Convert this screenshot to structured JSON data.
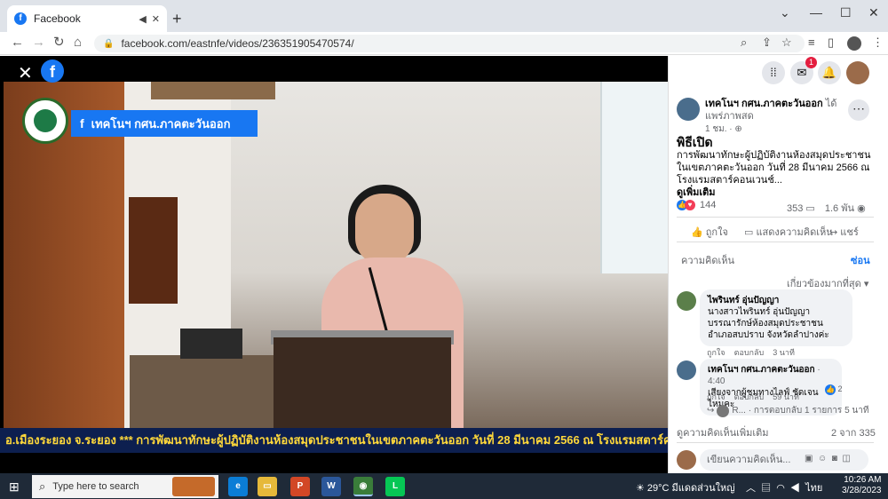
{
  "browser": {
    "tab_title": "Facebook",
    "new_tab": "+",
    "url": "facebook.com/eastnfe/videos/236351905470574/",
    "window_controls": [
      "⌄",
      "—",
      "☐",
      "✕"
    ]
  },
  "video": {
    "close_icon": "✕",
    "page_banner": "เทคโนฯ กศน.ภาคตะวันออก",
    "ticker": "อ.เมืองระยอง จ.ระยอง   *** การพัฒนาทักษะผู้ปฏิบัติงานห้องสมุดประชาชนในเขตภาคตะวันออก วันที่ 28 มีนาคม 2566 ณ โรงแรมสตาร์คอน"
  },
  "panel": {
    "notification_count": "1",
    "post": {
      "author": "เทคโนฯ กศน.ภาคตะวันออก",
      "author_suffix": "ได้แพร่ภาพสด",
      "time": "1 ชม. · ",
      "title": "พิธีเปิด",
      "description": "การพัฒนาทักษะผู้ปฏิบัติงานห้องสมุดประชาชนในเขตภาคตะวันออก วันที่ 28 มีนาคม 2566 ณ โรงแรมสตาร์คอนเวนช์...",
      "see_more": "ดูเพิ่มเติม",
      "reactions_count": "144",
      "comments_count": "353",
      "views_count": "1.6 พัน"
    },
    "actions": {
      "like": "ถูกใจ",
      "comment": "แสดงความคิดเห็น",
      "share": "แชร์"
    },
    "comments_label": "ความคิดเห็น",
    "hide_label": "ซ่อน",
    "sort_label": "เกี่ยวข้องมากที่สุด",
    "comments": [
      {
        "author": "ไพรินทร์ อุ่นปัญญา",
        "text": "นางสาวไพรินทร์ อุ่นปัญญา บรรณารักษ์ห้องสมุดประชาชนอำเภอสบปราบ จังหวัดลำปางค่ะ",
        "like": "ถูกใจ",
        "reply": "ตอบกลับ",
        "time": "3 นาที"
      },
      {
        "author": "เทคโนฯ กศน.ภาคตะวันออก",
        "timestamp": "4:40",
        "text": "เสียงจากผู้ชมทางไลฟ์ ชัดเจนไหมคะ",
        "like": "ถูกใจ",
        "reply": "ตอบกลับ",
        "time": "59 นาที",
        "reaction_count": "2"
      }
    ],
    "reply_row": {
      "name": "R...",
      "text": "· การตอบกลับ 1 รายการ",
      "time": "5 นาที"
    },
    "more_comments": "ดูความคิดเห็นเพิ่มเติม",
    "more_count": "2 จาก 335",
    "comment_placeholder": "เขียนความคิดเห็น..."
  },
  "taskbar": {
    "search_placeholder": "Type here to search",
    "weather": "29°C  มีแดดส่วนใหญ่",
    "lang": "ไทย",
    "time": "10:26 AM",
    "date": "3/28/2023"
  }
}
